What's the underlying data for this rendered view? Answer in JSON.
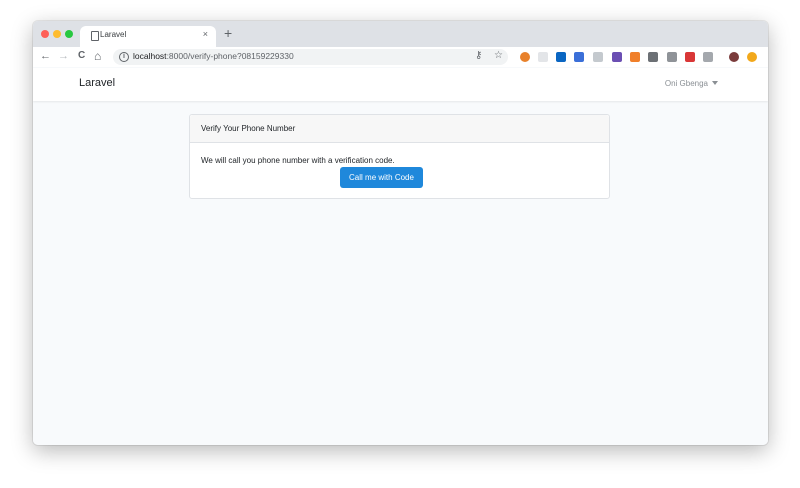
{
  "browser": {
    "tab": {
      "title": "Laravel",
      "close_glyph": "×"
    },
    "new_tab_glyph": "+",
    "nav": {
      "back_glyph": "←",
      "forward_glyph": "→",
      "reload_glyph": "C",
      "home_glyph": "⌂"
    },
    "address": {
      "host": "localhost",
      "rest": ":8000/verify-phone?08159229330",
      "info_glyph": "i"
    },
    "omnibox_icons": [
      {
        "name": "key-icon",
        "glyph": "⚷"
      },
      {
        "name": "star-icon",
        "glyph": "☆"
      }
    ],
    "extensions": [
      {
        "name": "extension-orange-icon",
        "color": "#e8812b"
      },
      {
        "name": "extension-blank-icon",
        "color": "#e3e5e8"
      },
      {
        "name": "extension-linkedin-icon",
        "color": "#0a66c2"
      },
      {
        "name": "extension-pen-icon",
        "color": "#3b6fd8"
      },
      {
        "name": "extension-refresh-icon",
        "color": "#c4c9ce"
      },
      {
        "name": "extension-purple-icon",
        "color": "#6b4fb3"
      },
      {
        "name": "extension-layers-icon",
        "color": "#f07f2a"
      },
      {
        "name": "extension-camera-icon",
        "color": "#6c7075"
      },
      {
        "name": "extension-shield-icon",
        "color": "#8f9398"
      },
      {
        "name": "extension-red-icon",
        "color": "#d93737"
      },
      {
        "name": "extension-gray-icon",
        "color": "#a4a8ad"
      },
      {
        "name": "profile-avatar-icon",
        "color": "#7a3b3b"
      },
      {
        "name": "extension-yellow-icon",
        "color": "#f2a81b"
      }
    ]
  },
  "navbar": {
    "brand": "Laravel",
    "user_name": "Oni Gbenga"
  },
  "card": {
    "header": "Verify Your Phone Number",
    "body_text": "We will call you phone number with a verification code.",
    "button_label": "Call me with Code"
  },
  "colors": {
    "primary_button": "#1f88db",
    "traffic_close": "#fe5f57",
    "traffic_min": "#febc2e",
    "traffic_max": "#28c840"
  }
}
